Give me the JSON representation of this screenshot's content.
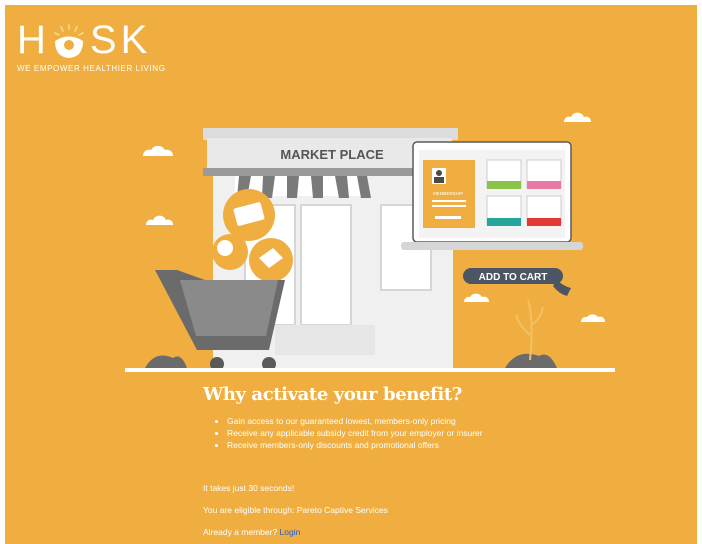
{
  "brand": {
    "logo_letters": [
      "H",
      "SK"
    ],
    "tagline": "WE EMPOWER HEALTHIER LIVING"
  },
  "illustration": {
    "store_sign": "MARKET PLACE",
    "card_label": "MEMBERSHIP",
    "cta_label": "ADD TO CART"
  },
  "content": {
    "heading": "Why activate your benefit?",
    "benefits": [
      "Gain access to our guaranteed lowest, members-only pricing",
      "Receive any applicable subsidy credit from your employer or insurer",
      "Receive members-only discounts and promotional offers"
    ],
    "time_note": "It takes just 30 seconds!",
    "eligibility_prefix": "You are eligible through:",
    "eligibility_provider": "Pareto Captive Services",
    "member_prompt": "Already a member?",
    "login_label": "Login"
  },
  "colors": {
    "background": "#efae3f",
    "accent_dark": "#4b5563",
    "link": "#1f5fd6",
    "green": "#8bc34a",
    "pink": "#e67aa4",
    "teal": "#26a69a",
    "red": "#e53935"
  }
}
